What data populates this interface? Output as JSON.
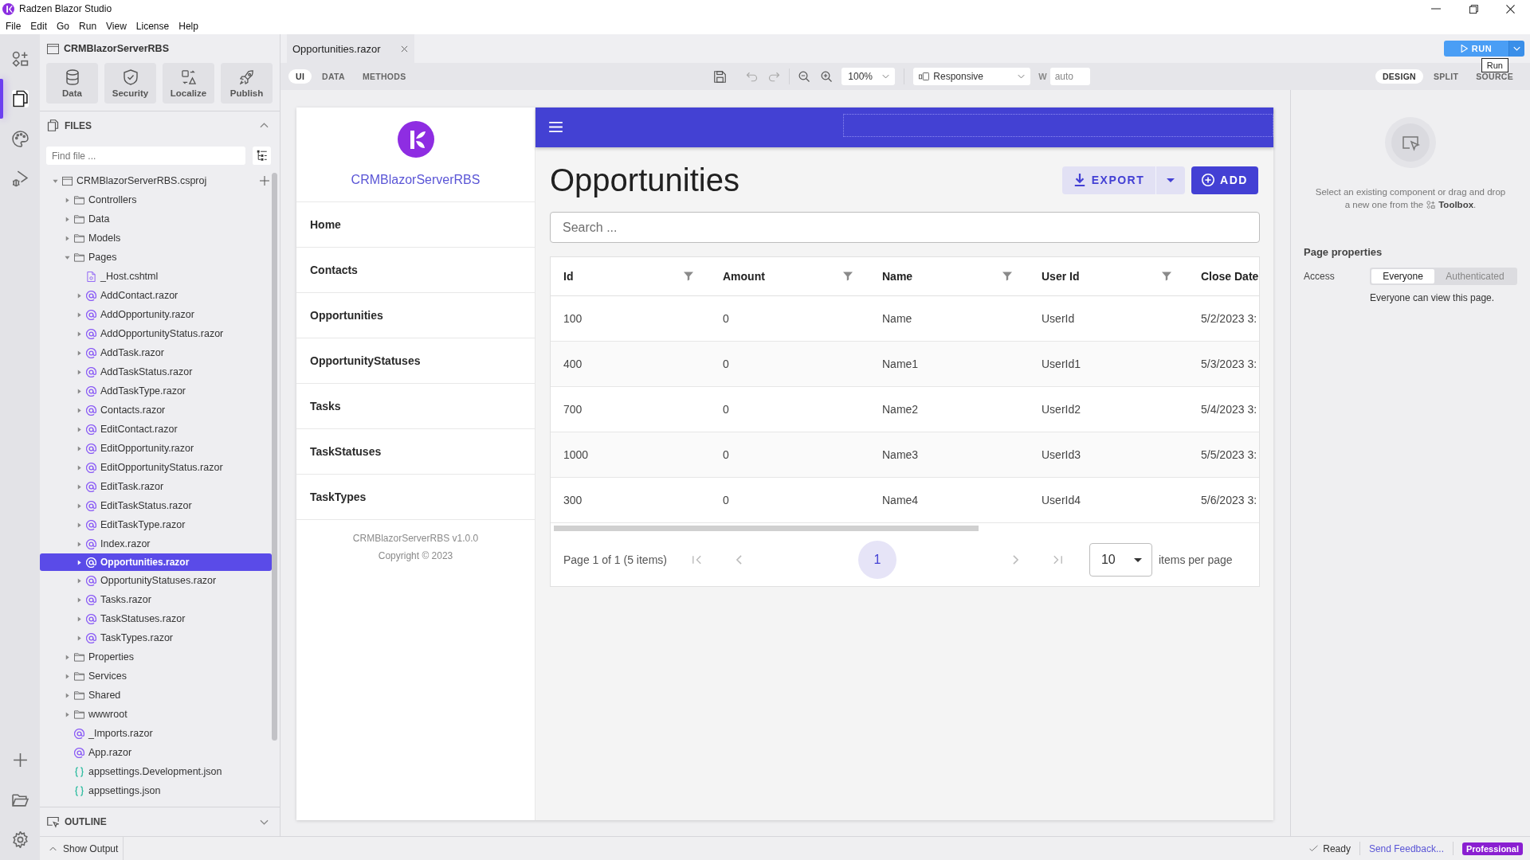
{
  "window": {
    "title": "Radzen Blazor Studio"
  },
  "menu": [
    "File",
    "Edit",
    "Go",
    "Run",
    "View",
    "License",
    "Help"
  ],
  "activity_bar": {
    "top": [
      {
        "kind": "toolbox",
        "selected": false
      },
      {
        "kind": "files",
        "selected": true
      },
      {
        "kind": "theme",
        "selected": false
      },
      {
        "kind": "debug",
        "selected": false
      }
    ],
    "bottom": [
      {
        "kind": "add"
      },
      {
        "kind": "folder"
      },
      {
        "kind": "settings"
      }
    ]
  },
  "sidebar": {
    "project": "CRMBlazorServerRBS",
    "actions": [
      {
        "kind": "data",
        "label": "Data"
      },
      {
        "kind": "security",
        "label": "Security"
      },
      {
        "kind": "localize",
        "label": "Localize"
      },
      {
        "kind": "publish",
        "label": "Publish"
      }
    ],
    "files": {
      "title": "FILES",
      "expanded": true,
      "placeholder": "Find file ..."
    },
    "tree": [
      {
        "name": "CRMBlazorServerRBS.csproj",
        "kind": "project",
        "expanded": true,
        "selected": false,
        "children": [
          {
            "name": "Controllers",
            "kind": "folder",
            "expanded": false,
            "selected": false
          },
          {
            "name": "Data",
            "kind": "folder",
            "expanded": false,
            "selected": false
          },
          {
            "name": "Models",
            "kind": "folder",
            "expanded": false,
            "selected": false
          },
          {
            "name": "Pages",
            "kind": "folder",
            "expanded": true,
            "selected": false,
            "children": [
              {
                "name": "_Host.cshtml",
                "kind": "page",
                "selected": false
              },
              {
                "name": "AddContact.razor",
                "kind": "razor",
                "expanded": false,
                "selected": false
              },
              {
                "name": "AddOpportunity.razor",
                "kind": "razor",
                "expanded": false,
                "selected": false
              },
              {
                "name": "AddOpportunityStatus.razor",
                "kind": "razor",
                "expanded": false,
                "selected": false
              },
              {
                "name": "AddTask.razor",
                "kind": "razor",
                "expanded": false,
                "selected": false
              },
              {
                "name": "AddTaskStatus.razor",
                "kind": "razor",
                "expanded": false,
                "selected": false
              },
              {
                "name": "AddTaskType.razor",
                "kind": "razor",
                "expanded": false,
                "selected": false
              },
              {
                "name": "Contacts.razor",
                "kind": "razor",
                "expanded": false,
                "selected": false
              },
              {
                "name": "EditContact.razor",
                "kind": "razor",
                "expanded": false,
                "selected": false
              },
              {
                "name": "EditOpportunity.razor",
                "kind": "razor",
                "expanded": false,
                "selected": false
              },
              {
                "name": "EditOpportunityStatus.razor",
                "kind": "razor",
                "expanded": false,
                "selected": false
              },
              {
                "name": "EditTask.razor",
                "kind": "razor",
                "expanded": false,
                "selected": false
              },
              {
                "name": "EditTaskStatus.razor",
                "kind": "razor",
                "expanded": false,
                "selected": false
              },
              {
                "name": "EditTaskType.razor",
                "kind": "razor",
                "expanded": false,
                "selected": false
              },
              {
                "name": "Index.razor",
                "kind": "razor",
                "expanded": false,
                "selected": false
              },
              {
                "name": "Opportunities.razor",
                "kind": "razor",
                "expanded": false,
                "selected": true
              },
              {
                "name": "OpportunityStatuses.razor",
                "kind": "razor",
                "expanded": false,
                "selected": false
              },
              {
                "name": "Tasks.razor",
                "kind": "razor",
                "expanded": false,
                "selected": false
              },
              {
                "name": "TaskStatuses.razor",
                "kind": "razor",
                "expanded": false,
                "selected": false
              },
              {
                "name": "TaskTypes.razor",
                "kind": "razor",
                "expanded": false,
                "selected": false
              }
            ]
          },
          {
            "name": "Properties",
            "kind": "folder",
            "expanded": false,
            "selected": false
          },
          {
            "name": "Services",
            "kind": "folder",
            "expanded": false,
            "selected": false
          },
          {
            "name": "Shared",
            "kind": "folder",
            "expanded": false,
            "selected": false
          },
          {
            "name": "wwwroot",
            "kind": "folder",
            "expanded": false,
            "selected": false
          },
          {
            "name": "_Imports.razor",
            "kind": "razor",
            "selected": false
          },
          {
            "name": "App.razor",
            "kind": "razor",
            "selected": false
          },
          {
            "name": "appsettings.Development.json",
            "kind": "json",
            "selected": false
          },
          {
            "name": "appsettings.json",
            "kind": "json",
            "selected": false
          }
        ]
      }
    ],
    "outline": {
      "title": "OUTLINE",
      "expanded": false
    }
  },
  "editor": {
    "tabs": [
      {
        "label": "Opportunities.razor",
        "selected": true
      }
    ],
    "run_button": "RUN",
    "tooltip": "Run",
    "modes": [
      {
        "label": "UI",
        "selected": true
      },
      {
        "label": "DATA",
        "selected": false
      },
      {
        "label": "METHODS",
        "selected": false
      }
    ],
    "zoom": "100%",
    "device": "Responsive",
    "width": {
      "label": "W",
      "placeholder": "auto"
    },
    "views": [
      {
        "label": "DESIGN",
        "selected": true
      },
      {
        "label": "SPLIT",
        "selected": false
      },
      {
        "label": "SOURCE",
        "selected": false
      }
    ]
  },
  "preview": {
    "brand": "CRMBlazorServerRBS",
    "nav": [
      "Home",
      "Contacts",
      "Opportunities",
      "OpportunityStatuses",
      "Tasks",
      "TaskStatuses",
      "TaskTypes"
    ],
    "footer": [
      "CRMBlazorServerRBS v1.0.0",
      "Copyright © 2023"
    ],
    "title": "Opportunities",
    "export_button": "EXPORT",
    "add_button": "ADD",
    "search": {
      "placeholder": "Search ..."
    },
    "table": {
      "columns": [
        {
          "label": "Id",
          "filterable": true
        },
        {
          "label": "Amount",
          "filterable": true
        },
        {
          "label": "Name",
          "filterable": true
        },
        {
          "label": "User Id",
          "filterable": true
        },
        {
          "label": "Close Date",
          "filterable": false
        }
      ],
      "rows": [
        [
          "100",
          "0",
          "Name",
          "UserId",
          "5/2/2023 3:"
        ],
        [
          "400",
          "0",
          "Name1",
          "UserId1",
          "5/3/2023 3:"
        ],
        [
          "700",
          "0",
          "Name2",
          "UserId2",
          "5/4/2023 3:"
        ],
        [
          "1000",
          "0",
          "Name3",
          "UserId3",
          "5/5/2023 3:"
        ],
        [
          "300",
          "0",
          "Name4",
          "UserId4",
          "5/6/2023 3:"
        ]
      ]
    },
    "pager": {
      "summary": "Page 1 of 1 (5 items)",
      "pages": [
        {
          "label": "1",
          "selected": true
        }
      ],
      "page_size": "10",
      "page_size_label": "items per page"
    }
  },
  "properties": {
    "hint": [
      "Select an existing component or drag and drop",
      "a new one from the"
    ],
    "hint_target": "**Toolbox**.",
    "title": "Page properties",
    "access": {
      "label": "Access",
      "options": [
        {
          "label": "Everyone",
          "selected": true
        },
        {
          "label": "Authenticated",
          "selected": false
        }
      ],
      "note": "Everyone can view this page."
    }
  },
  "status_bar": {
    "output": "Show Output",
    "status": "Ready",
    "feedback": "Send Feedback...",
    "license": "Professional"
  }
}
